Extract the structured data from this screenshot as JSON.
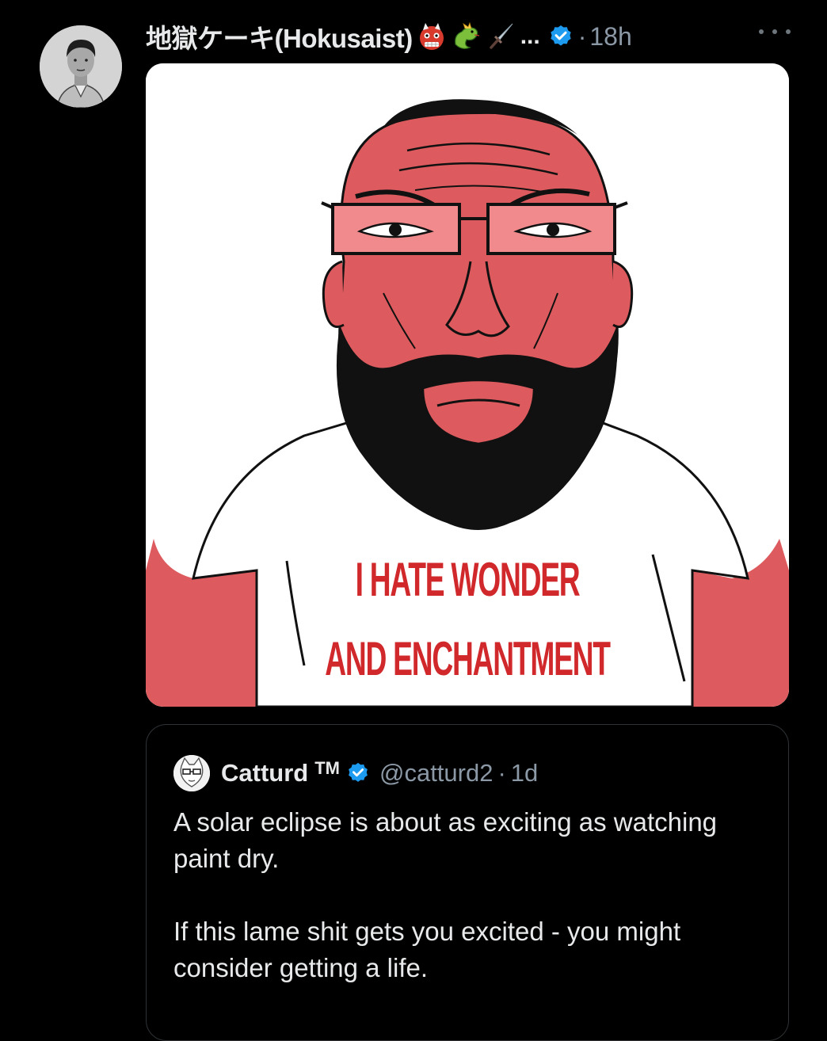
{
  "tweet": {
    "author": {
      "display_name": "地獄ケーキ(Hokusaist)",
      "name_emojis": [
        "ogre-emoji",
        "dragon-emoji",
        "dagger-emoji"
      ],
      "name_overflow": "...",
      "verified": true,
      "avatar": "black-and-white-portrait"
    },
    "separator": "·",
    "timestamp": "18h",
    "more_icon": "more-dots-icon",
    "media": {
      "shirt_text_line_1": "I HATE WONDER",
      "shirt_text_line_2": "AND ENCHANTMENT"
    },
    "quoted_tweet": {
      "display_name": "Catturd",
      "trademark": "TM",
      "verified": true,
      "handle": "@catturd2",
      "separator": "·",
      "timestamp": "1d",
      "text_paragraph_1": "A solar eclipse is about as exciting as watching paint dry.",
      "text_paragraph_2": "If this lame shit gets you excited - you might consider getting a life."
    }
  },
  "colors": {
    "background": "#000000",
    "primary_text": "#e7e9ea",
    "secondary_text": "#8b98a5",
    "verified_blue": "#1d9bf0",
    "border": "#2f3336",
    "meme_skin": "#dd5b5e",
    "meme_text_red": "#d0282b"
  }
}
